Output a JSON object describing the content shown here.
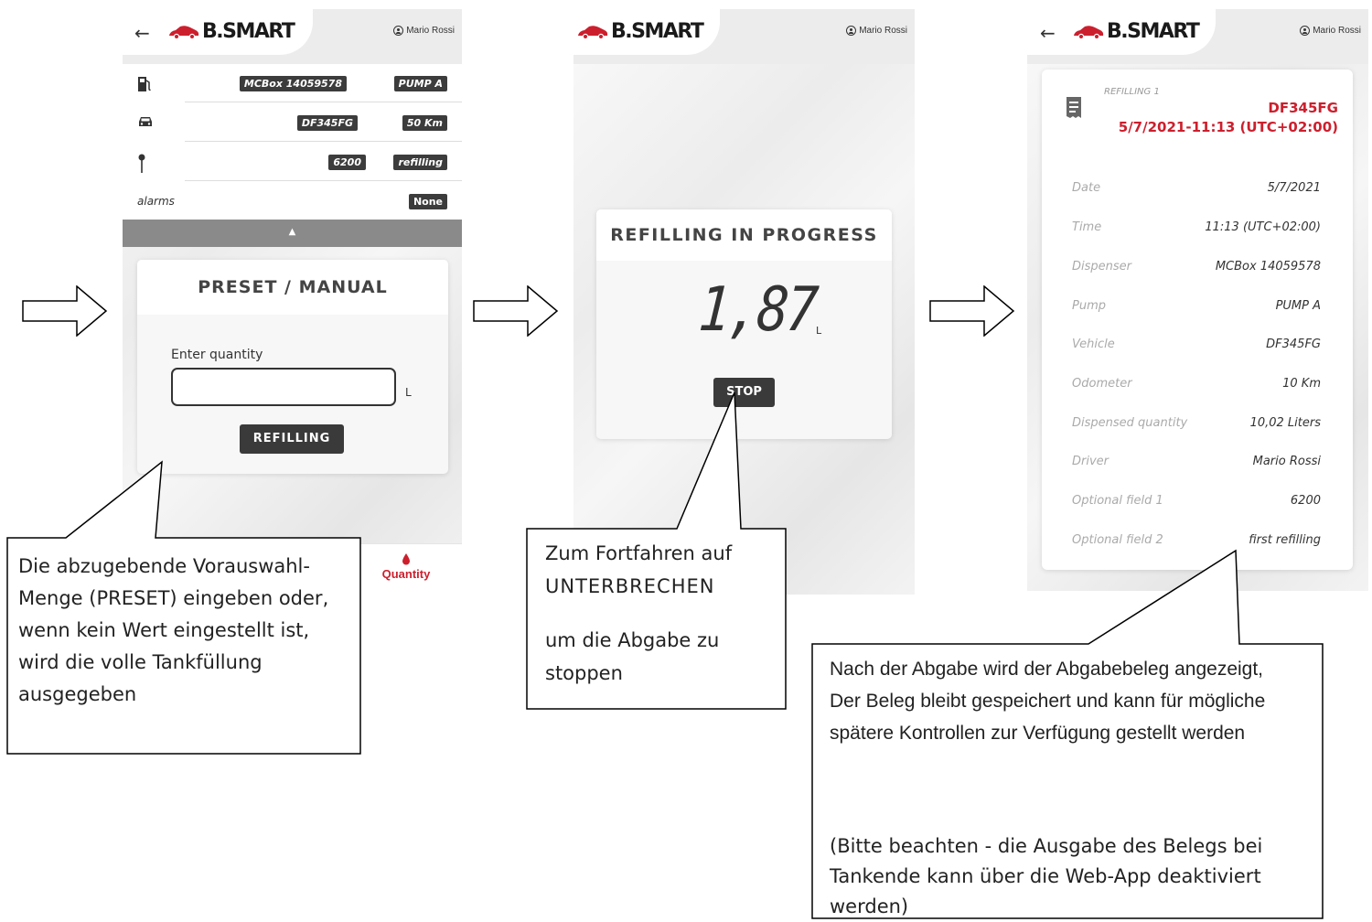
{
  "brand": {
    "logo_text": "B.SMART",
    "accent": "#cc1f2d"
  },
  "user": {
    "name": "Mario Rossi"
  },
  "screen1": {
    "rows": [
      {
        "icon": "fuel-pump-icon",
        "tags": [
          "MCBox 14059578",
          "PUMP A"
        ]
      },
      {
        "icon": "car-icon",
        "tags": [
          "DF345FG",
          "50 Km"
        ]
      },
      {
        "icon": "pin-icon",
        "tags": [
          "6200",
          "refilling"
        ]
      }
    ],
    "alarms_label": "alarms",
    "alarms_value": "None",
    "card_title": "PRESET / MANUAL",
    "quantity_label": "Enter quantity",
    "quantity_value": "",
    "unit": "L",
    "refill_button": "REFILLING",
    "bottom_tab": "Quantity"
  },
  "screen2": {
    "card_title": "REFILLING IN PROGRESS",
    "readout": "1,87",
    "unit": "L",
    "stop_button": "STOP"
  },
  "screen3": {
    "refilling_label": "REFILLING 1",
    "plate": "DF345FG",
    "datetime": "5/7/2021-11:13 (UTC+02:00)",
    "rows": [
      {
        "label": "Date",
        "value": "5/7/2021"
      },
      {
        "label": "Time",
        "value": "11:13 (UTC+02:00)"
      },
      {
        "label": "Dispenser",
        "value": "MCBox 14059578"
      },
      {
        "label": "Pump",
        "value": "PUMP A"
      },
      {
        "label": "Vehicle",
        "value": "DF345FG"
      },
      {
        "label": "Odometer",
        "value": "10 Km"
      },
      {
        "label": "Dispensed quantity",
        "value": "10,02 Liters"
      },
      {
        "label": "Driver",
        "value": "Mario Rossi"
      },
      {
        "label": "Optional field 1",
        "value": "6200"
      },
      {
        "label": "Optional field 2",
        "value": "first refilling"
      }
    ]
  },
  "callouts": {
    "c1": "Die abzugebende Vorauswahl-Menge (PRESET) eingeben oder, wenn kein Wert eingestellt ist, wird die volle Tankfüllung ausgegeben",
    "c2_line1": "Zum Fortfahren auf",
    "c2_line2": "UNTERBRECHEN",
    "c2_line3": "um die Abgabe zu stoppen",
    "c3_p1": "Nach der Abgabe wird der Abgabebeleg angezeigt, Der Beleg bleibt gespeichert und kann für mögliche spätere Kontrollen zur Verfügung gestellt werden",
    "c3_p2": "(Bitte beachten - die Ausgabe des Belegs bei Tankende kann über die Web-App deaktiviert werden)"
  }
}
